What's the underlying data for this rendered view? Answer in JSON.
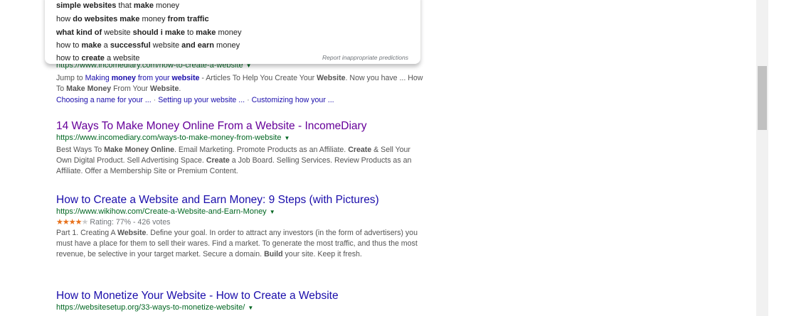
{
  "autocomplete": {
    "items": [
      [
        [
          "simple websites",
          true
        ],
        [
          " that ",
          false
        ],
        [
          "make",
          true
        ],
        [
          " money",
          false
        ]
      ],
      [
        [
          "how ",
          false
        ],
        [
          "do websites make",
          true
        ],
        [
          " money ",
          false
        ],
        [
          "from traffic",
          true
        ]
      ],
      [
        [
          "what kind of",
          true
        ],
        [
          " website ",
          false
        ],
        [
          "should i make",
          true
        ],
        [
          " to ",
          false
        ],
        [
          "make",
          true
        ],
        [
          " money",
          false
        ]
      ],
      [
        [
          "how to ",
          false
        ],
        [
          "make",
          true
        ],
        [
          " a ",
          false
        ],
        [
          "successful",
          true
        ],
        [
          " website ",
          false
        ],
        [
          "and earn",
          true
        ],
        [
          " money",
          false
        ]
      ],
      [
        [
          "how to ",
          false
        ],
        [
          "create",
          true
        ],
        [
          " a website",
          false
        ]
      ]
    ],
    "report_label": "Report inappropriate predictions"
  },
  "results": [
    {
      "url_partial": "https://www.incomediary.com/how-to-create-a-website",
      "snippet": [
        [
          "Jump to ",
          "t"
        ],
        [
          "Making ",
          "l"
        ],
        [
          "money",
          "lb"
        ],
        [
          " from your ",
          "l"
        ],
        [
          "website",
          "lb"
        ],
        [
          " - Articles To Help You Create Your ",
          "t"
        ],
        [
          "Website",
          "b"
        ],
        [
          ". Now you have ... How To ",
          "t"
        ],
        [
          "Make Money",
          "b"
        ],
        [
          " From Your ",
          "t"
        ],
        [
          "Website",
          "b"
        ],
        [
          ".",
          "t"
        ]
      ],
      "sitelinks": [
        "Choosing a name for your ...",
        "Setting up your website ...",
        "Customizing how your ..."
      ]
    },
    {
      "title": "14 Ways To Make Money Online From a Website - IncomeDiary",
      "visited": true,
      "url": "https://www.incomediary.com/ways-to-make-money-from-website",
      "snippet": [
        [
          "Best Ways To ",
          "t"
        ],
        [
          "Make Money Online",
          "b"
        ],
        [
          ". Email Marketing. Promote Products as an Affiliate. ",
          "t"
        ],
        [
          "Create",
          "b"
        ],
        [
          " & Sell Your Own Digital Product. Sell Advertising Space. ",
          "t"
        ],
        [
          "Create",
          "b"
        ],
        [
          " a Job Board. Selling Services. Review Products as an Affiliate. Offer a Membership Site or Premium Content.",
          "t"
        ]
      ]
    },
    {
      "title": "How to Create a Website and Earn Money: 9 Steps (with Pictures)",
      "visited": false,
      "url": "https://www.wikihow.com/Create-a-Website-and-Earn-Money",
      "rating_text": "Rating: 77% - 426 votes",
      "stars": 4,
      "stars_total": 5,
      "snippet": [
        [
          "Part 1. Creating A ",
          "t"
        ],
        [
          "Website",
          "b"
        ],
        [
          ". Define your goal. In order to attract any investors (in the form of advertisers) you must have a place for them to sell their wares. Find a market. To generate the most traffic, and thus the most revenue, be selective in your target market. Secure a domain. ",
          "t"
        ],
        [
          "Build",
          "b"
        ],
        [
          " your site. Keep it fresh.",
          "t"
        ]
      ]
    },
    {
      "title": "How to Monetize Your Website - How to Create a Website",
      "visited": false,
      "url": "https://websitesetup.org/33-ways-to-monetize-website/"
    }
  ],
  "icons": {
    "url_dropdown": "caret-down-icon",
    "rating_star": "star-icon"
  },
  "colors": {
    "link": "#1a0dab",
    "visited": "#660099",
    "url": "#006621",
    "star": "#e7711b"
  }
}
